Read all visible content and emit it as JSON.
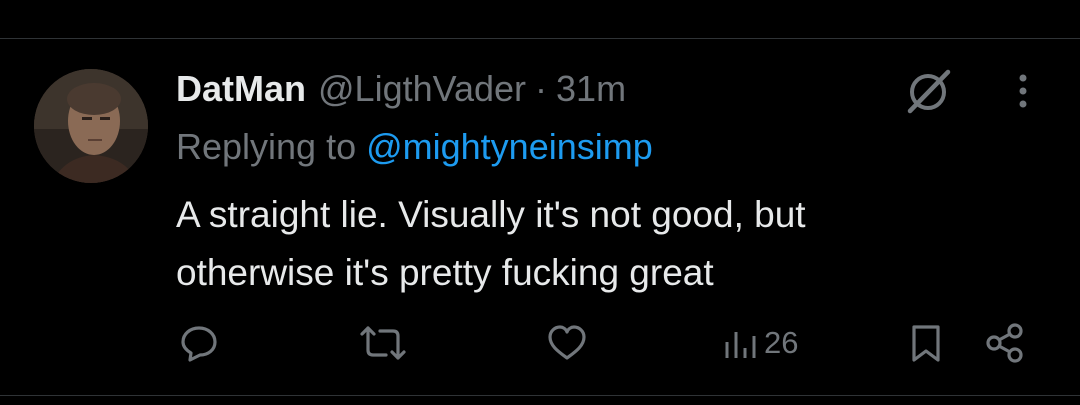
{
  "tweet": {
    "author": {
      "display_name": "DatMan",
      "handle": "@LigthVader",
      "separator": "·",
      "time_ago": "31m"
    },
    "reply": {
      "prefix": "Replying to",
      "mention": "@mightyneinsimp"
    },
    "text_lines": [
      "A straight lie. Visually it's not good, but",
      "otherwise it's pretty fucking great"
    ],
    "actions": {
      "views_count": "26"
    }
  },
  "icons": {
    "grok": "grok-icon",
    "more": "more-icon",
    "reply": "reply-icon",
    "retweet": "retweet-icon",
    "like": "like-icon",
    "views": "views-icon",
    "bookmark": "bookmark-icon",
    "share": "share-icon"
  },
  "colors": {
    "background": "#000000",
    "primary_text": "#e7e9ea",
    "secondary_text": "#71767b",
    "link": "#1d9bf0",
    "divider": "#2f3336"
  }
}
